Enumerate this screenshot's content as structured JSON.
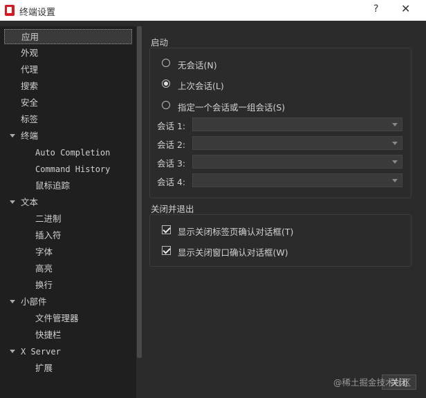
{
  "window": {
    "title": "终端设置",
    "help": "?",
    "close": "✕"
  },
  "nav": {
    "items": [
      {
        "label": "应用",
        "selected": true
      },
      {
        "label": "外观"
      },
      {
        "label": "代理"
      },
      {
        "label": "搜索"
      },
      {
        "label": "安全"
      },
      {
        "label": "标签"
      },
      {
        "label": "终端",
        "expanded": true
      },
      {
        "label": "Auto Completion"
      },
      {
        "label": "Command History"
      },
      {
        "label": "鼠标追踪"
      },
      {
        "label": "文本",
        "expanded": true
      },
      {
        "label": "二进制"
      },
      {
        "label": "插入符"
      },
      {
        "label": "字体"
      },
      {
        "label": "高亮"
      },
      {
        "label": "换行"
      },
      {
        "label": "小部件",
        "expanded": true
      },
      {
        "label": "文件管理器"
      },
      {
        "label": "快捷栏"
      },
      {
        "label": "X Server",
        "expanded": true
      },
      {
        "label": "扩展"
      }
    ]
  },
  "startup": {
    "title": "启动",
    "options": [
      {
        "label": "无会话(N)",
        "checked": false
      },
      {
        "label": "上次会话(L)",
        "checked": true
      },
      {
        "label": "指定一个会话或一组会话(S)",
        "checked": false
      }
    ],
    "sessions": [
      {
        "label": "会话 1:",
        "value": ""
      },
      {
        "label": "会话 2:",
        "value": ""
      },
      {
        "label": "会话 3:",
        "value": ""
      },
      {
        "label": "会话 4:",
        "value": ""
      }
    ]
  },
  "exit": {
    "title": "关闭并退出",
    "checks": [
      {
        "label": "显示关闭标签页确认对话框(T)",
        "checked": true
      },
      {
        "label": "显示关闭窗口确认对话框(W)",
        "checked": true
      }
    ]
  },
  "footer": {
    "close_label": "关闭",
    "watermark": "@稀土掘金技术社区"
  }
}
